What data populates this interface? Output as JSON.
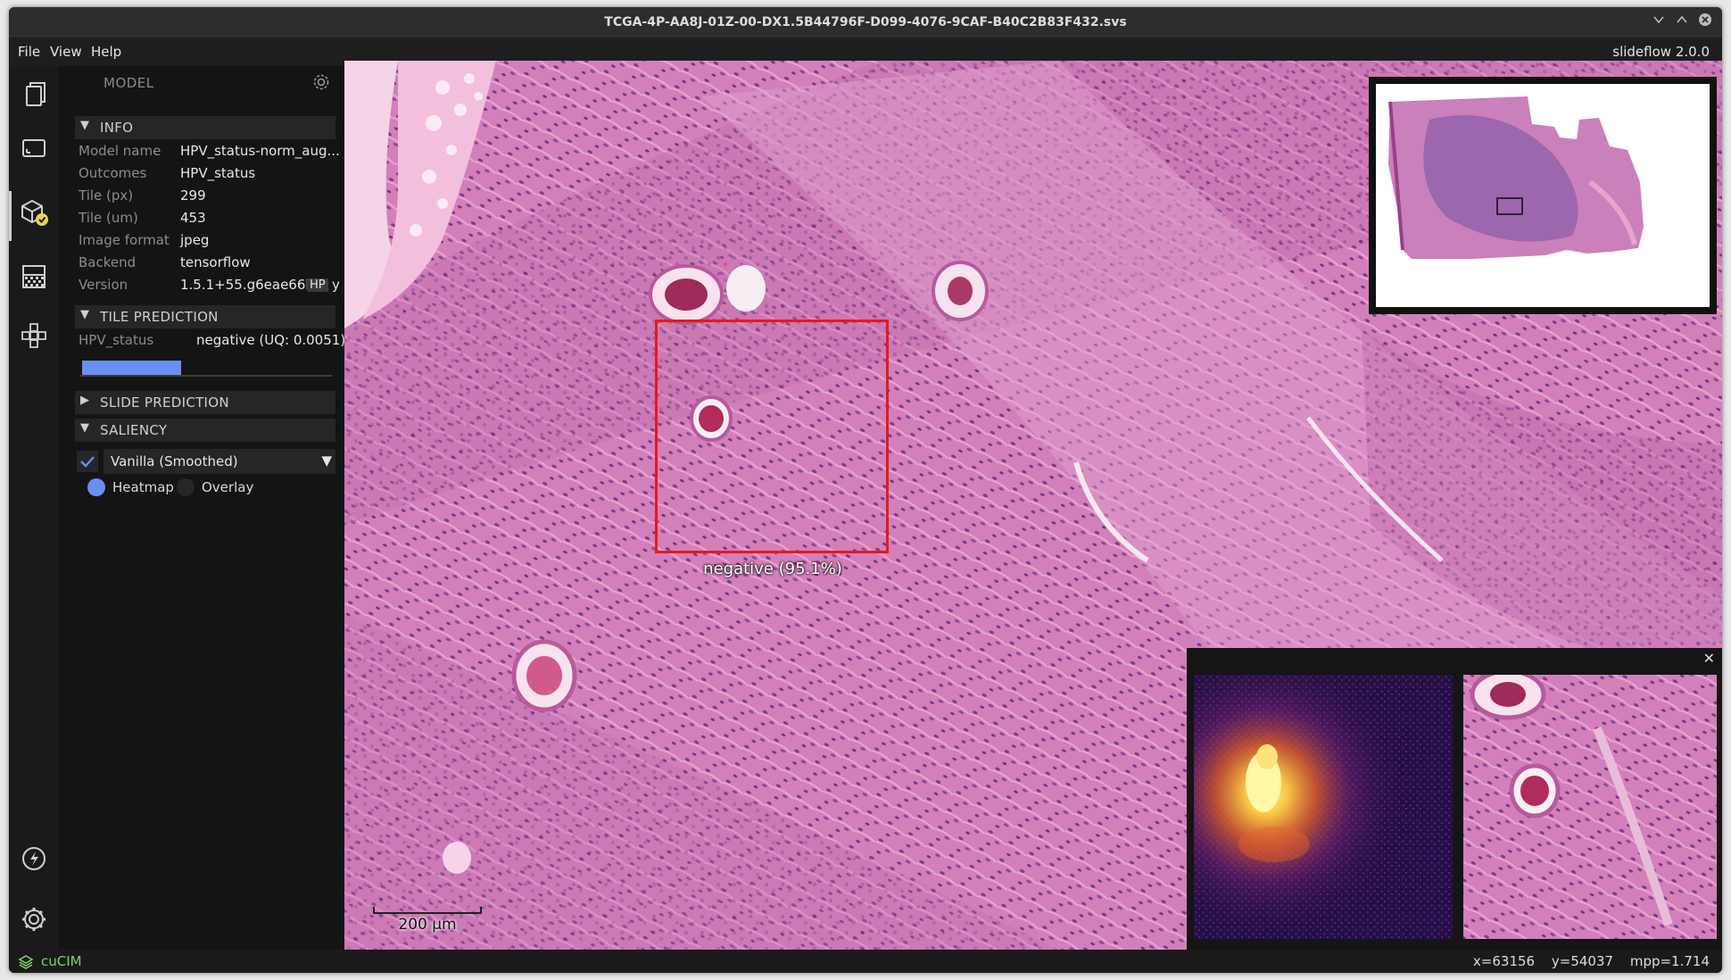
{
  "window": {
    "title": "TCGA-4P-AA8J-01Z-00-DX1.5B44796F-D099-4076-9CAF-B40C2B83F432.svs"
  },
  "menu": {
    "items": [
      "File",
      "View",
      "Help"
    ],
    "app_version": "slideflow 2.0.0"
  },
  "sidebar_icons": [
    "files-icon",
    "slide-icon",
    "model-icon",
    "heatmap-icon",
    "extensions-icon",
    "performance-icon",
    "settings-icon"
  ],
  "panel": {
    "title": "MODEL",
    "info_section": "INFO",
    "info": [
      {
        "key": "Model name",
        "value": "HPV_status-norm_aug..."
      },
      {
        "key": "Outcomes",
        "value": "HPV_status"
      },
      {
        "key": "Tile (px)",
        "value": "299"
      },
      {
        "key": "Tile (um)",
        "value": "453"
      },
      {
        "key": "Image format",
        "value": "jpeg"
      },
      {
        "key": "Backend",
        "value": "tensorflow"
      },
      {
        "key": "Version",
        "value": "1.5.1+55.g6eae66be"
      }
    ],
    "version_tooltip": "HP",
    "version_tail": "y",
    "tile_prediction_section": "TILE PREDICTION",
    "tile_prediction": {
      "outcome": "HPV_status",
      "value": "negative (UQ: 0.0051)",
      "bar_fraction": 0.4
    },
    "slide_prediction_section": "SLIDE PREDICTION",
    "saliency_section": "SALIENCY",
    "saliency": {
      "enabled": true,
      "method": "Vanilla (Smoothed)",
      "modes": [
        "Heatmap",
        "Overlay"
      ],
      "selected_mode": "Heatmap"
    }
  },
  "viewer": {
    "prediction_label": "negative (95.1%)",
    "scale_label": "200 µm"
  },
  "status": {
    "library": "cuCIM",
    "x": "x=63156",
    "y": "y=54037",
    "mpp": "mpp=1.714"
  },
  "colors": {
    "accent": "#6b8ff0",
    "prediction_box": "#e41a1c",
    "library": "#7ad46a",
    "tissue_pink": "#d97fb8",
    "tissue_purple": "#8f4a98"
  }
}
